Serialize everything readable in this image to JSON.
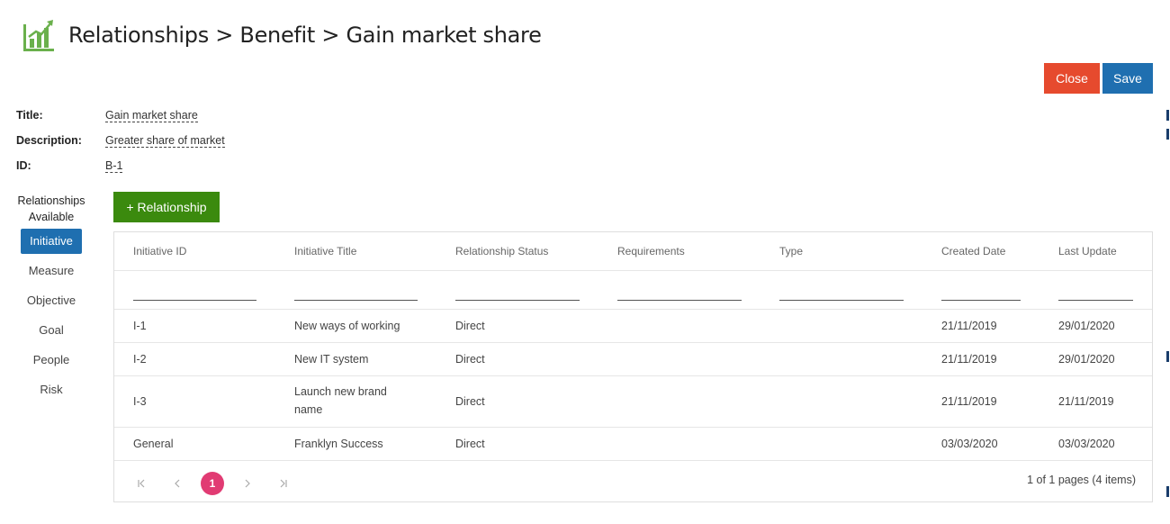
{
  "header": {
    "icon": "bar-chart-growth-icon",
    "icon_color": "#6ab04c",
    "title": "Relationships > Benefit > Gain market share"
  },
  "actions": {
    "close_label": "Close",
    "save_label": "Save",
    "close_color": "#e64a2e",
    "save_color": "#1f6fb0"
  },
  "fields": [
    {
      "label": "Title:",
      "value": "Gain market share"
    },
    {
      "label": "Description:",
      "value": "Greater share of market"
    },
    {
      "label": "ID:",
      "value": "B-1"
    }
  ],
  "relationships": {
    "heading_line1": "Relationships",
    "heading_line2": "Available",
    "items": [
      "Initiative",
      "Measure",
      "Objective",
      "Goal",
      "People",
      "Risk"
    ],
    "active": "Initiative",
    "add_label": "+ Relationship",
    "add_color": "#3b8a0e"
  },
  "grid": {
    "columns": [
      "Initiative ID",
      "Initiative Title",
      "Relationship Status",
      "Requirements",
      "Type",
      "Created Date",
      "Last Update"
    ],
    "rows": [
      {
        "id": "I-1",
        "title": "New ways of working",
        "status": "Direct",
        "requirements": "",
        "type": "",
        "created": "21/11/2019",
        "updated": "29/01/2020"
      },
      {
        "id": "I-2",
        "title": "New IT system",
        "status": "Direct",
        "requirements": "",
        "type": "",
        "created": "21/11/2019",
        "updated": "29/01/2020"
      },
      {
        "id": "I-3",
        "title_line1": "Launch new brand",
        "title_line2": "name",
        "status": "Direct",
        "requirements": "",
        "type": "",
        "created": "21/11/2019",
        "updated": "21/11/2019"
      },
      {
        "id": "General",
        "title": "Franklyn Success",
        "status": "Direct",
        "requirements": "",
        "type": "",
        "created": "03/03/2020",
        "updated": "03/03/2020"
      }
    ]
  },
  "pager": {
    "first": "|<",
    "prev": "<",
    "current": "1",
    "next": ">",
    "last": ">|",
    "info": "1 of 1 pages (4 items)",
    "current_color": "#e13b73"
  }
}
